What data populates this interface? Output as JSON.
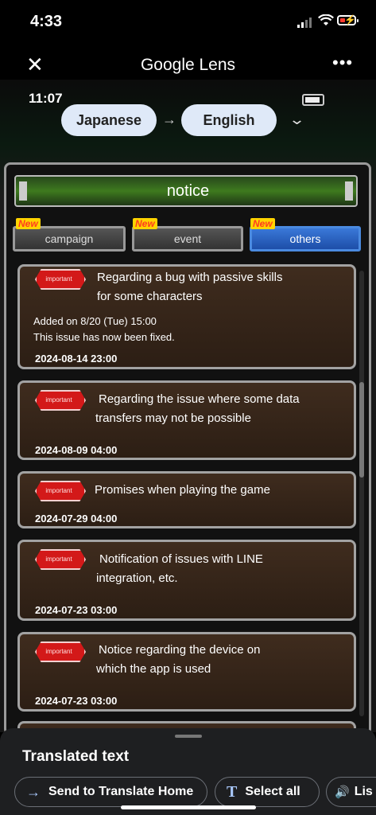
{
  "status": {
    "time": "4:33"
  },
  "lens": {
    "title": "Google Lens",
    "close_icon": "✕",
    "menu_icon": "•••"
  },
  "screenshot_status": {
    "time": "11:07"
  },
  "translate": {
    "source_lang": "Japanese",
    "arrow": "→",
    "target_lang": "English",
    "expand_icon": "⌄"
  },
  "notice": {
    "title": "notice"
  },
  "tabs": [
    {
      "label": "campaign",
      "badge": "New"
    },
    {
      "label": "event",
      "badge": "New"
    },
    {
      "label": "others",
      "badge": "New"
    }
  ],
  "badge_label": "important",
  "notices": [
    {
      "title_line1": "Regarding a bug with passive skills",
      "title_line2": "for some characters",
      "body_line1": "Added on 8/20 (Tue) 15:00",
      "body_line2": "This issue has now been fixed.",
      "date": "2024-08-14 23:00"
    },
    {
      "title_line1": "Regarding the issue where some data",
      "title_line2": "transfers may not be possible",
      "date": "2024-08-09 04:00"
    },
    {
      "title_line1": "Promises when playing the game",
      "date": "2024-07-29 04:00"
    },
    {
      "title_line1": "Notification of issues with LINE",
      "title_line2": "integration, etc.",
      "date": "2024-07-23 03:00"
    },
    {
      "title_line1": "Notice regarding the device on",
      "title_line2": "which the app is used",
      "date": "2024-07-23 03:00"
    }
  ],
  "sheet": {
    "title": "Translated text",
    "actions": [
      {
        "label": "Send to Translate Home",
        "icon": "→"
      },
      {
        "label": "Select all",
        "icon": "T"
      },
      {
        "label": "Lis",
        "icon": "🔊"
      }
    ]
  },
  "colors": {
    "accent_blue": "#a8c7fa",
    "tab_active": "#2f66c4",
    "notice_green": "#3e7a1e",
    "important_red": "#d31919"
  }
}
